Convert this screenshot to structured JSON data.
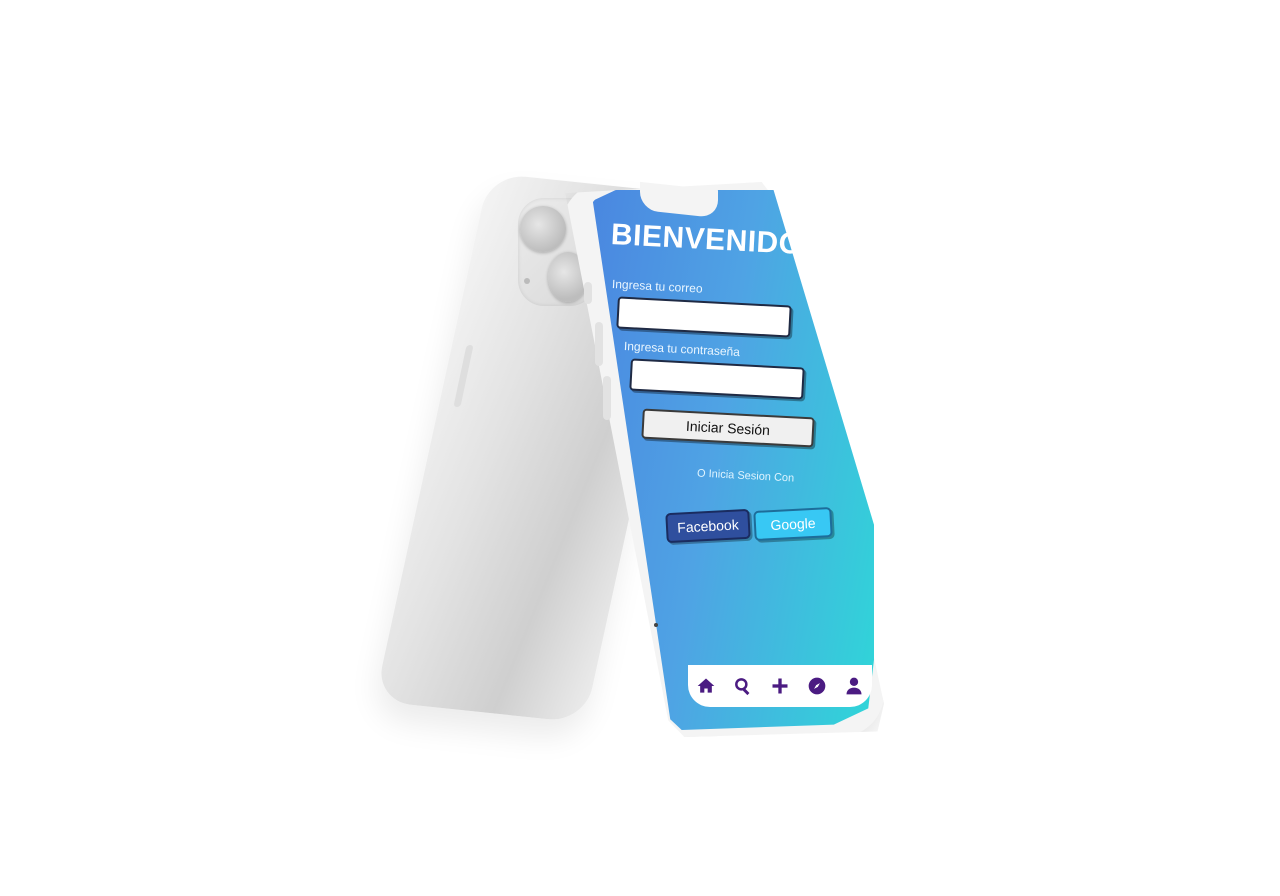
{
  "login": {
    "title": "BIENVENIDO",
    "email_label": "Ingresa tu correo",
    "email_value": "",
    "password_label": "Ingresa tu contraseña",
    "password_value": "",
    "login_button": "Iniciar Sesión",
    "or_text": "O Inicia Sesion Con",
    "facebook_button": "Facebook",
    "google_button": "Google"
  },
  "bottom_nav": {
    "items": [
      {
        "icon": "home-icon"
      },
      {
        "icon": "search-icon"
      },
      {
        "icon": "plus-icon"
      },
      {
        "icon": "compass-icon"
      },
      {
        "icon": "user-icon"
      }
    ]
  },
  "colors": {
    "gradient_start": "#4a86e0",
    "gradient_end": "#2fd6d8",
    "facebook": "#2f4f9e",
    "google": "#38c8f4",
    "nav_icon": "#4b1b82"
  }
}
